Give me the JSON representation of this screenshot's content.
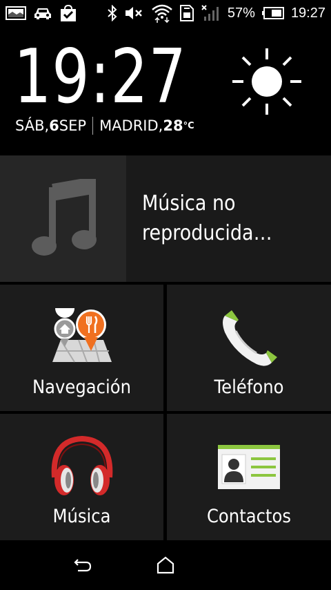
{
  "status_bar": {
    "battery_percent": "57%",
    "time": "19:27",
    "icons": [
      "image-icon",
      "car-icon",
      "bag-check-icon",
      "bluetooth-icon",
      "mute-icon",
      "wifi-icon",
      "sim-icon",
      "signal-icon",
      "battery-icon"
    ]
  },
  "clock": {
    "time": "19:27",
    "day": "SÁB, ",
    "date_num": "6",
    "month": " SEP",
    "city": "MADRID, ",
    "temperature": "28",
    "temp_unit": "°C",
    "weather_icon": "sun-icon"
  },
  "music": {
    "status": "Música no reproducida…",
    "icon": "music-note-icon"
  },
  "tiles": {
    "navigation": {
      "label": "Navegación",
      "icon": "map-pins-icon"
    },
    "phone": {
      "label": "Teléfono",
      "icon": "phone-icon"
    },
    "music": {
      "label": "Música",
      "icon": "headphones-icon"
    },
    "contacts": {
      "label": "Contactos",
      "icon": "contact-card-icon"
    }
  },
  "nav_bar": {
    "back_icon": "back-icon",
    "home_icon": "home-icon"
  },
  "colors": {
    "accent_green": "#8cc63f",
    "orange": "#f07020",
    "red": "#d32a2a",
    "tile_bg": "#1c1c1c"
  }
}
